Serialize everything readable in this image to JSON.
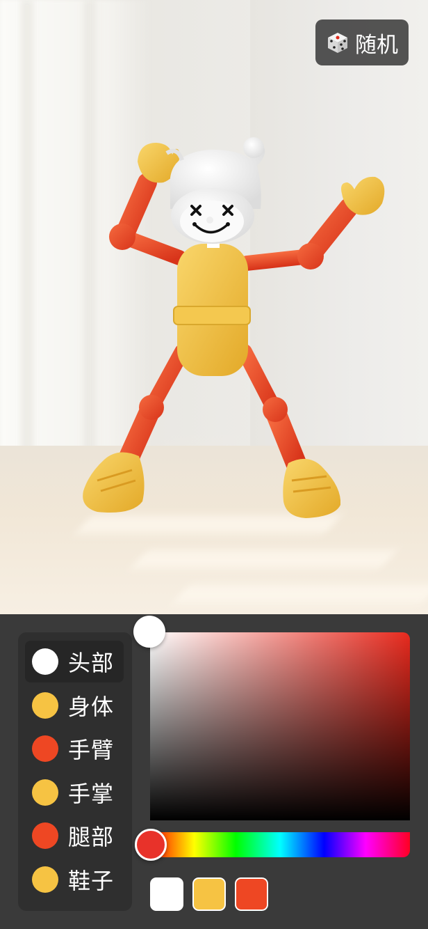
{
  "random_button": {
    "label": "随机",
    "icon": "dice-icon"
  },
  "colors": {
    "head": "#ffffff",
    "body": "#f6c343",
    "arm": "#ee4723",
    "hand": "#f6c343",
    "leg": "#ee4723",
    "shoe": "#f6c343",
    "picker_base": "#e82a1e"
  },
  "parts": [
    {
      "label": "头部",
      "color": "#ffffff",
      "selected": true
    },
    {
      "label": "身体",
      "color": "#f6c343",
      "selected": false
    },
    {
      "label": "手臂",
      "color": "#ee4723",
      "selected": false
    },
    {
      "label": "手掌",
      "color": "#f6c343",
      "selected": false
    },
    {
      "label": "腿部",
      "color": "#ee4723",
      "selected": false
    },
    {
      "label": "鞋子",
      "color": "#f6c343",
      "selected": false
    }
  ],
  "picker": {
    "hue_value": 0.02,
    "saturation": 0,
    "brightness": 1,
    "hue_handle_color": "#e8322a"
  },
  "presets": [
    "#ffffff",
    "#f6c343",
    "#ee4723"
  ]
}
